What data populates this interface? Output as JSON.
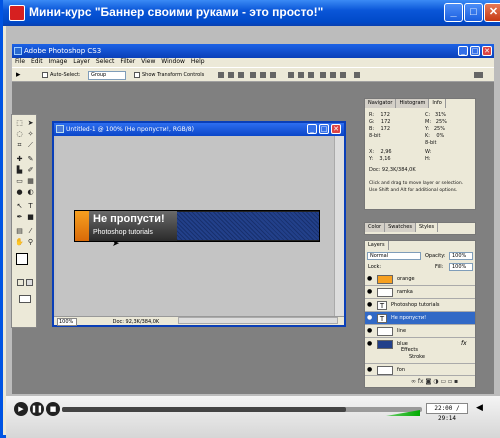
{
  "window": {
    "title": "Мини-курс \"Баннер своими руками - это просто!\"",
    "min": "_",
    "max": "□",
    "close": "✕"
  },
  "ps": {
    "title": "Adobe Photoshop CS3",
    "menu": [
      "File",
      "Edit",
      "Image",
      "Layer",
      "Select",
      "Filter",
      "View",
      "Window",
      "Help"
    ],
    "options": {
      "auto_select_label": "Auto-Select:",
      "auto_select_value": "Group",
      "show_transform_label": "Show Transform Controls"
    }
  },
  "document": {
    "title": "Untitled-1 @ 100% (Не пропусти!, RGB/8)",
    "zoom": "100%",
    "status_info": "Doc: 92,3K/384,0K",
    "banner_title": "Не пропусти!",
    "banner_subtitle": "Photoshop tutorials"
  },
  "info_panel": {
    "tabs": [
      "Navigator",
      "Histogram",
      "Info"
    ],
    "rgb_block": "R:    172\nG:    172\nB:    172\n8-bit",
    "cmyk_block": "C:   31%\nM:   25%\nY:   25%\nK:    0%\n8-bit",
    "xy_block": "X:    2,96\nY:    3,16",
    "wh_block": "W:\nH:",
    "doc": "Doc: 92,3K/384,0K",
    "help": "Click and drag to move layer or selection.\nUse Shift and Alt for additional options."
  },
  "color_panel": {
    "tabs": [
      "Color",
      "Swatches",
      "Styles"
    ]
  },
  "layers_panel": {
    "tabs": [
      "Layers"
    ],
    "blend_mode": "Normal",
    "opacity_label": "Opacity:",
    "opacity": "100%",
    "lock_label": "Lock:",
    "fill_label": "Fill:",
    "fill": "100%",
    "layers": [
      "orange",
      "ramka",
      "Photoshop tutorials",
      "Не пропусти!",
      "line",
      "blue",
      "Effects",
      "Stroke",
      "fon"
    ],
    "fx": "fx"
  },
  "player": {
    "time": "22:00 / 29:14",
    "progress_fraction": 0.79
  }
}
